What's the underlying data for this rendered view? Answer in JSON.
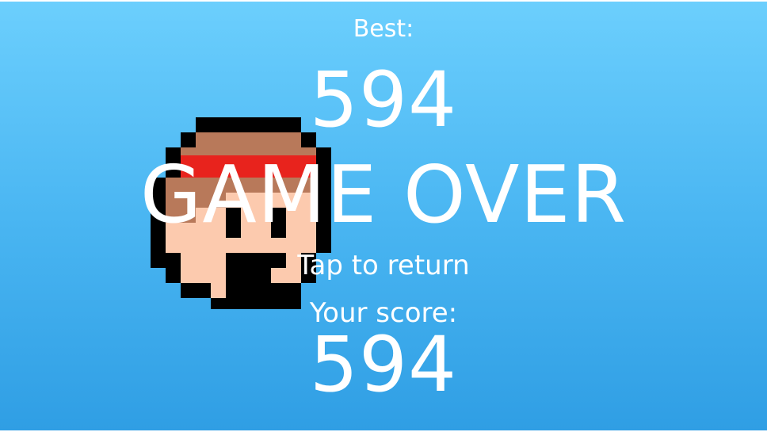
{
  "best": {
    "label": "Best:",
    "value": "594"
  },
  "game_over": {
    "title": "GAME OVER",
    "tap_prompt": "Tap to return"
  },
  "score": {
    "label": "Your score:",
    "value": "594"
  },
  "character": {
    "icon": "pixel-character-head-icon"
  },
  "colors": {
    "sky_top": "#6ccffd",
    "sky_bottom": "#2f9ee4",
    "text": "#ffffff",
    "headband": "#e8231d",
    "hair": "#b8795a",
    "skin": "#fccaae",
    "outline": "#000000"
  }
}
